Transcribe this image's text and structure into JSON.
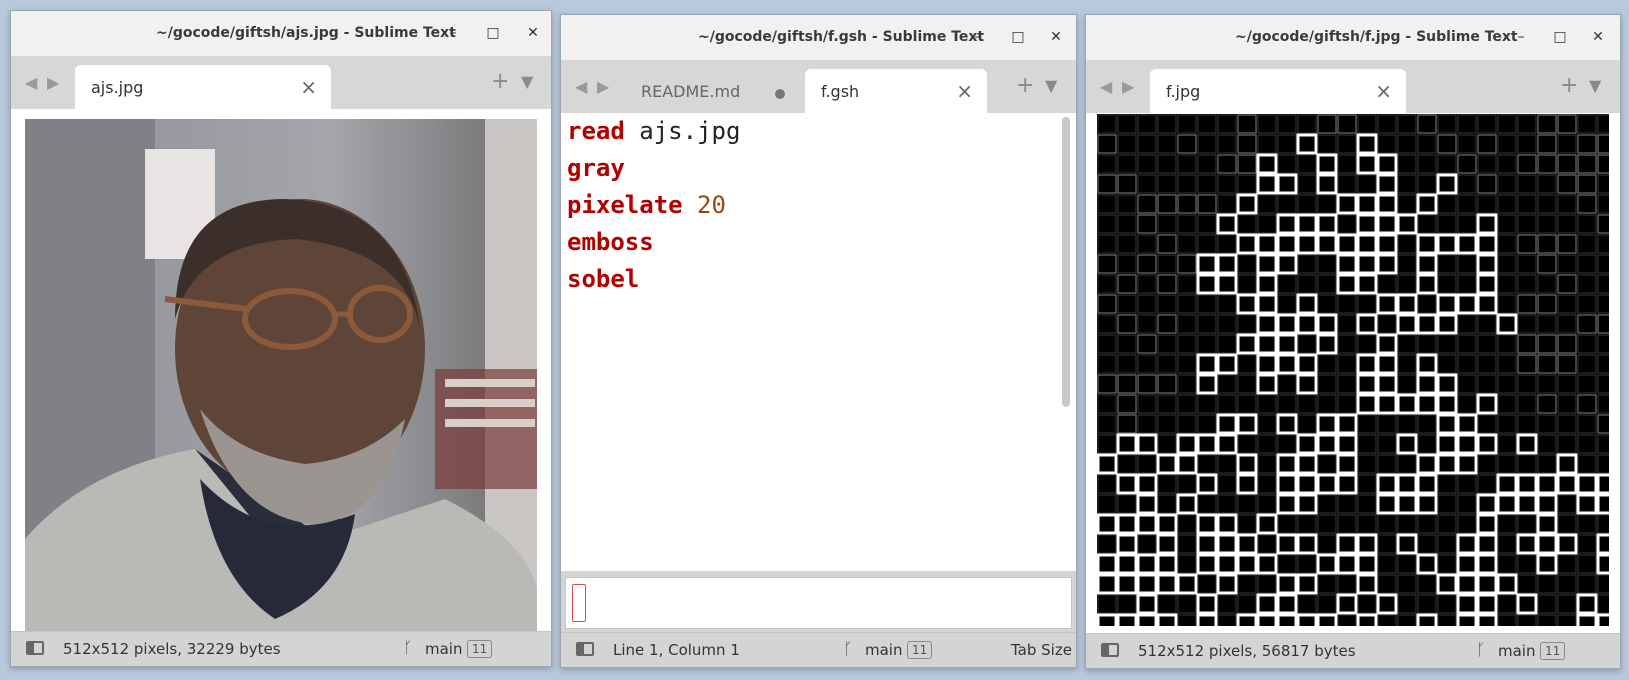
{
  "windows": [
    {
      "title": "~/gocode/giftsh/ajs.jpg - Sublime Text",
      "tabs": [
        {
          "label": "ajs.jpg",
          "active": true
        }
      ],
      "status": {
        "info": "512x512 pixels, 32229 bytes",
        "branch": "main",
        "badge": "11"
      }
    },
    {
      "title": "~/gocode/giftsh/f.gsh - Sublime Text",
      "tabs": [
        {
          "label": "README.md",
          "active": false
        },
        {
          "label": "f.gsh",
          "active": true
        }
      ],
      "code": [
        {
          "keyword": "read",
          "arg": "ajs.jpg"
        },
        {
          "keyword": "gray",
          "arg": ""
        },
        {
          "keyword": "pixelate",
          "arg": "20"
        },
        {
          "keyword": "emboss",
          "arg": ""
        },
        {
          "keyword": "sobel",
          "arg": ""
        }
      ],
      "status": {
        "info": "Line 1, Column 1",
        "branch": "main",
        "badge": "11",
        "extra": "Tab Size"
      }
    },
    {
      "title": "~/gocode/giftsh/f.jpg - Sublime Text",
      "tabs": [
        {
          "label": "f.jpg",
          "active": true
        }
      ],
      "status": {
        "info": "512x512 pixels, 56817 bytes",
        "branch": "main",
        "badge": "11"
      }
    }
  ],
  "icons": {
    "minimize": "minimize-icon",
    "maximize": "maximize-icon",
    "close": "close-icon",
    "back": "back-arrow-icon",
    "forward": "forward-arrow-icon",
    "new_tab": "plus-icon",
    "tab_list": "chevron-down-icon",
    "branch": "git-branch-icon",
    "sidebar": "sidebar-toggle-icon"
  },
  "colors": {
    "keyword": "#b00000",
    "number": "#a04510",
    "desktop": "#b9c9dc"
  }
}
